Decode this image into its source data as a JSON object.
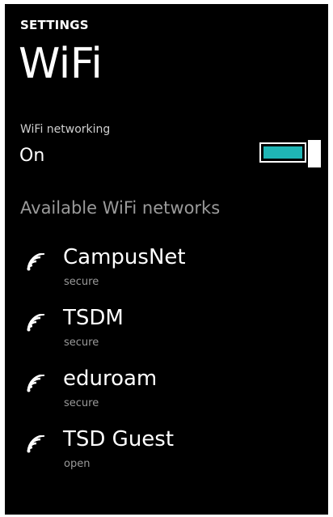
{
  "header": {
    "section": "SETTINGS",
    "title": "WiFi"
  },
  "wifi_toggle": {
    "caption": "WiFi networking",
    "state": "On",
    "on": true,
    "accent_color": "#1fb6b6"
  },
  "available": {
    "header": "Available WiFi networks",
    "networks": [
      {
        "name": "CampusNet",
        "security": "secure",
        "icon": "wifi-signal-icon"
      },
      {
        "name": "TSDM",
        "security": "secure",
        "icon": "wifi-signal-icon"
      },
      {
        "name": "eduroam",
        "security": "secure",
        "icon": "wifi-signal-icon"
      },
      {
        "name": "TSD Guest",
        "security": "open",
        "icon": "wifi-signal-icon"
      }
    ]
  }
}
